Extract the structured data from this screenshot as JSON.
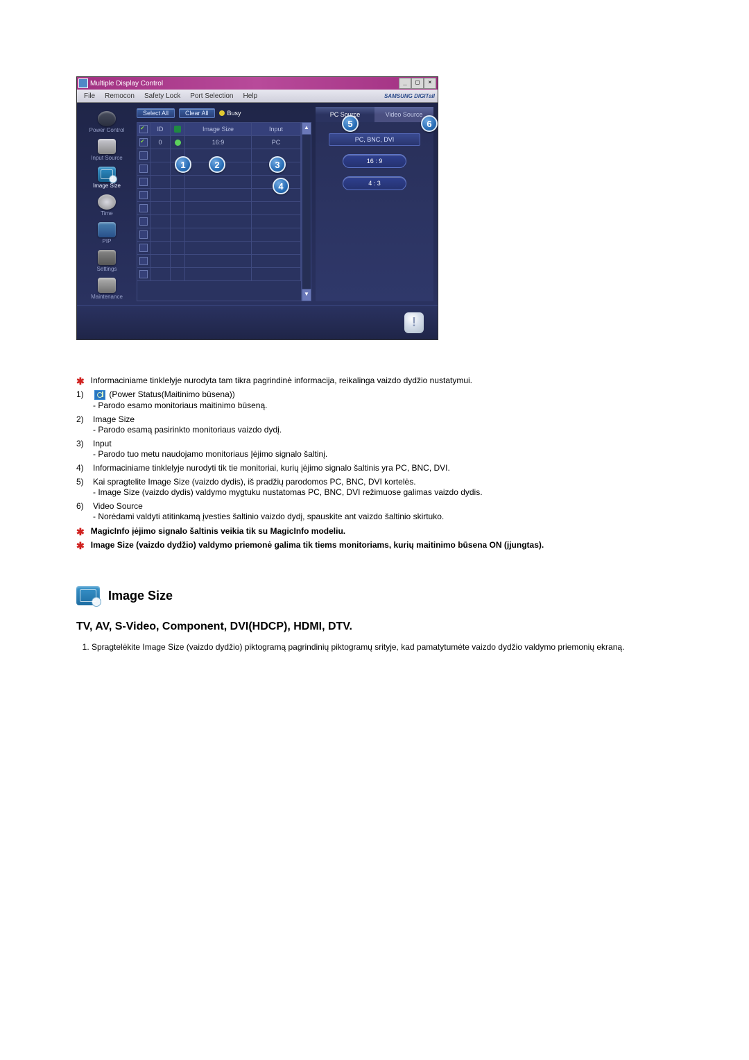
{
  "window": {
    "title": "Multiple Display Control",
    "win_minimize": "_",
    "win_maximize": "□",
    "win_close": "×",
    "brand": "SAMSUNG DIGITall"
  },
  "menubar": {
    "file": "File",
    "remocon": "Remocon",
    "safety_lock": "Safety Lock",
    "port_selection": "Port Selection",
    "help": "Help"
  },
  "sidebar": {
    "items": [
      {
        "label": "Power Control"
      },
      {
        "label": "Input Source"
      },
      {
        "label": "Image Size"
      },
      {
        "label": "Time"
      },
      {
        "label": "PIP"
      },
      {
        "label": "Settings"
      },
      {
        "label": "Maintenance"
      }
    ]
  },
  "toolbar": {
    "select_all": "Select All",
    "clear_all": "Clear All",
    "busy": "Busy"
  },
  "grid": {
    "headers": {
      "id": "ID",
      "image_size": "Image Size",
      "input": "Input"
    },
    "rows": [
      {
        "checked": true,
        "id": "0",
        "status": "on",
        "image_size": "16:9",
        "input": "PC"
      },
      {
        "checked": false,
        "id": "",
        "status": "",
        "image_size": "",
        "input": ""
      },
      {
        "checked": false,
        "id": "",
        "status": "",
        "image_size": "",
        "input": ""
      },
      {
        "checked": false,
        "id": "",
        "status": "",
        "image_size": "",
        "input": ""
      },
      {
        "checked": false,
        "id": "",
        "status": "",
        "image_size": "",
        "input": ""
      },
      {
        "checked": false,
        "id": "",
        "status": "",
        "image_size": "",
        "input": ""
      },
      {
        "checked": false,
        "id": "",
        "status": "",
        "image_size": "",
        "input": ""
      },
      {
        "checked": false,
        "id": "",
        "status": "",
        "image_size": "",
        "input": ""
      },
      {
        "checked": false,
        "id": "",
        "status": "",
        "image_size": "",
        "input": ""
      },
      {
        "checked": false,
        "id": "",
        "status": "",
        "image_size": "",
        "input": ""
      },
      {
        "checked": false,
        "id": "",
        "status": "",
        "image_size": "",
        "input": ""
      }
    ]
  },
  "right_panel": {
    "tab_pc": "PC Source",
    "tab_video": "Video Source",
    "mode_label": "PC, BNC, DVI",
    "ratio_169": "16 : 9",
    "ratio_43": "4 : 3"
  },
  "callouts": {
    "c1": "1",
    "c2": "2",
    "c3": "3",
    "c4": "4",
    "c5": "5",
    "c6": "6"
  },
  "desc": {
    "intro": "Informaciniame tinklelyje nurodyta tam tikra pagrindinė informacija, reikalinga vaizdo dydžio nustatymui.",
    "items": [
      {
        "num": "1)",
        "title_pre": "",
        "title_icon": true,
        "title_post": "(Power Status(Maitinimo būsena))",
        "subs": [
          "Parodo esamo monitoriaus maitinimo būseną."
        ]
      },
      {
        "num": "2)",
        "title": "Image Size",
        "subs": [
          "Parodo esamą pasirinkto monitoriaus vaizdo dydį."
        ]
      },
      {
        "num": "3)",
        "title": "Input",
        "subs": [
          "Parodo tuo metu naudojamo monitoriaus Įėjimo signalo šaltinį."
        ]
      },
      {
        "num": "4)",
        "title": "Informaciniame tinklelyje nurodyti tik tie monitoriai, kurių įėjimo signalo šaltinis yra PC, BNC, DVI.",
        "subs": []
      },
      {
        "num": "5)",
        "title": "Kai spragtelite Image Size (vaizdo dydis), iš pradžių parodomos PC, BNC, DVI kortelės.",
        "subs": [
          "Image Size (vaizdo dydis) valdymo mygtuku nustatomas PC, BNC, DVI režimuose galimas vaizdo dydis."
        ]
      },
      {
        "num": "6)",
        "title": "Video Source",
        "subs": [
          "Norėdami valdyti atitinkamą įvesties šaltinio vaizdo dydį, spauskite ant vaizdo šaltinio skirtuko."
        ]
      }
    ],
    "note1": "MagicInfo įėjimo signalo šaltinis veikia tik su MagicInfo modeliu.",
    "note2": "Image Size (vaizdo dydžio) valdymo priemonė galima tik tiems monitoriams, kurių maitinimo būsena ON (įjungtas)."
  },
  "section": {
    "title": "Image Size",
    "subtitle": "TV, AV, S-Video, Component, DVI(HDCP), HDMI, DTV.",
    "ol1": "Spragtelėkite Image Size (vaizdo dydžio) piktogramą pagrindinių piktogramų srityje, kad pamatytumėte vaizdo dydžio valdymo priemonių ekraną."
  }
}
